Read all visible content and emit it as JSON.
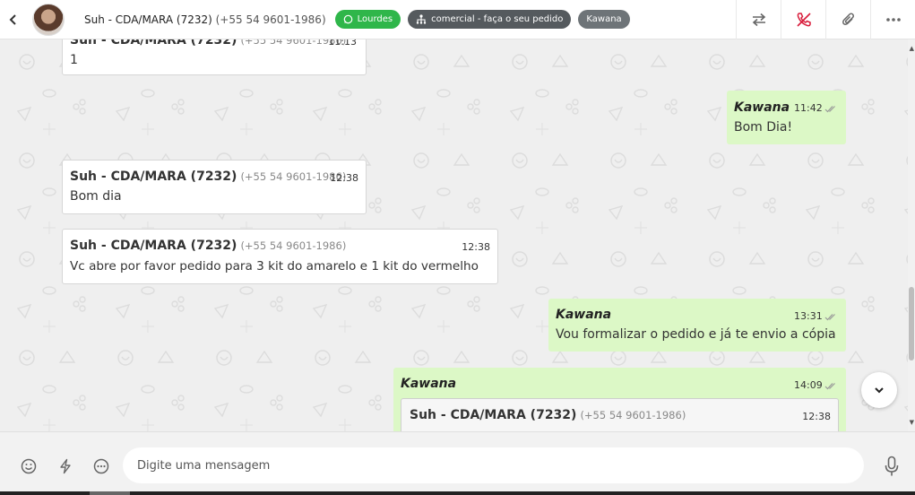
{
  "header": {
    "contact_name": "Suh - CDA/MARA (7232)",
    "contact_phone": "(+55 54 9601-1986)",
    "tags": {
      "whatsapp": "Lourdes",
      "department": "comercial - faça o seu pedido",
      "agent": "Kawana"
    },
    "colors": {
      "whatsapp_tag": "#2fb64a",
      "department_tag": "#555a5e",
      "agent_tag": "#6e7478",
      "end_call": "#d81b3a"
    },
    "icons": [
      "transfer-icon",
      "end-call-icon",
      "attach-icon",
      "more-icon"
    ]
  },
  "messages": [
    {
      "id": "m0",
      "direction": "in",
      "sender": "Suh - CDA/MARA (7232)",
      "phone": "(+55 54 9601-1986)",
      "time": "11:13",
      "text": "1"
    },
    {
      "id": "m1",
      "direction": "out",
      "sender": "Kawana",
      "time": "11:42",
      "text": "Bom Dia!"
    },
    {
      "id": "m2",
      "direction": "in",
      "sender": "Suh - CDA/MARA (7232)",
      "phone": "(+55 54 9601-1986)",
      "time": "12:38",
      "text": "Bom dia"
    },
    {
      "id": "m3",
      "direction": "in",
      "sender": "Suh - CDA/MARA (7232)",
      "phone": "(+55 54 9601-1986)",
      "time": "12:38",
      "text": "Vc abre por favor pedido para 3 kit do amarelo e 1 kit do vermelho"
    },
    {
      "id": "m4",
      "direction": "out",
      "sender": "Kawana",
      "time": "13:31",
      "text": "Vou formalizar o pedido e já te envio a cópia"
    },
    {
      "id": "m5",
      "direction": "out",
      "sender": "Kawana",
      "time": "14:09",
      "quote": {
        "sender": "Suh - CDA/MARA (7232)",
        "phone": "(+55 54 9601-1986)",
        "time": "12:38"
      }
    }
  ],
  "composer": {
    "placeholder": "Digite uma mensagem",
    "value": "",
    "icons": [
      "emoji-icon",
      "quick-reply-icon",
      "more-options-icon",
      "microphone-icon"
    ]
  },
  "chat_colors": {
    "background": "#efefef",
    "incoming": "#ffffff",
    "outgoing": "#dcf8c6"
  }
}
